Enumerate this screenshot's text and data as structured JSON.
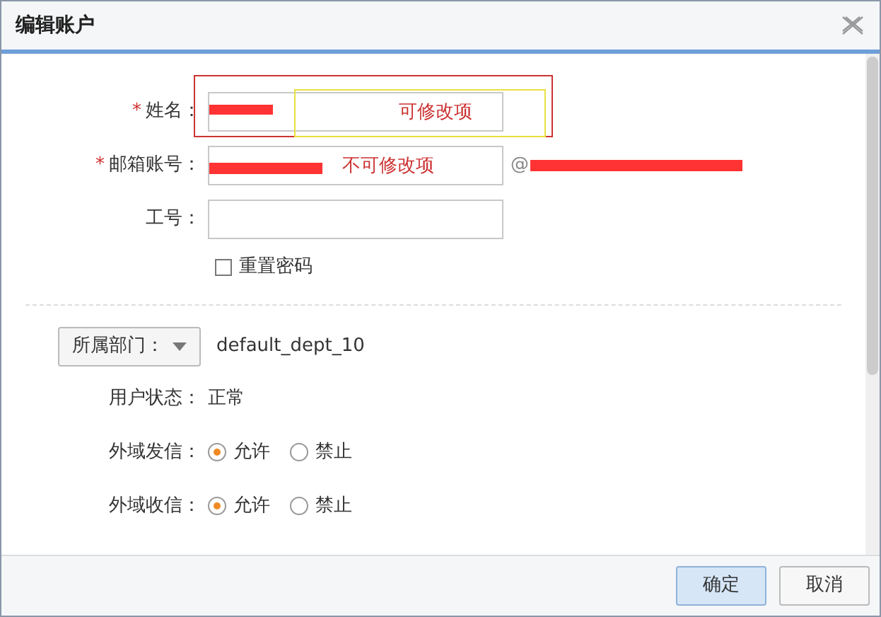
{
  "dialog": {
    "title": "编辑账户"
  },
  "fields": [
    {
      "label": "姓名：",
      "mark": "*",
      "redacted": true,
      "highlighted": true,
      "annotation": "可修改项"
    },
    {
      "label": "邮箱账号：",
      "mark": "*",
      "redacted": true,
      "highlighted": false,
      "annotation": "不可修改项",
      "suffix": "@"
    },
    {
      "label": "工号：",
      "redacted": false,
      "highlighted": false
    }
  ],
  "reset_password": {
    "label": "重置密码",
    "checked": false
  },
  "department": {
    "button": "所属部门：",
    "value": "default_dept_10"
  },
  "status": {
    "label": "用户状态：",
    "value": "正常"
  },
  "radio_groups": [
    {
      "label": "外域发信：",
      "options": [
        {
          "label": "允许",
          "selected": true
        },
        {
          "label": "禁止",
          "selected": false
        }
      ]
    },
    {
      "label": "外域收信：",
      "options": [
        {
          "label": "允许",
          "selected": true
        },
        {
          "label": "禁止",
          "selected": false
        }
      ]
    }
  ],
  "buttons": [
    "确定",
    "取消"
  ]
}
